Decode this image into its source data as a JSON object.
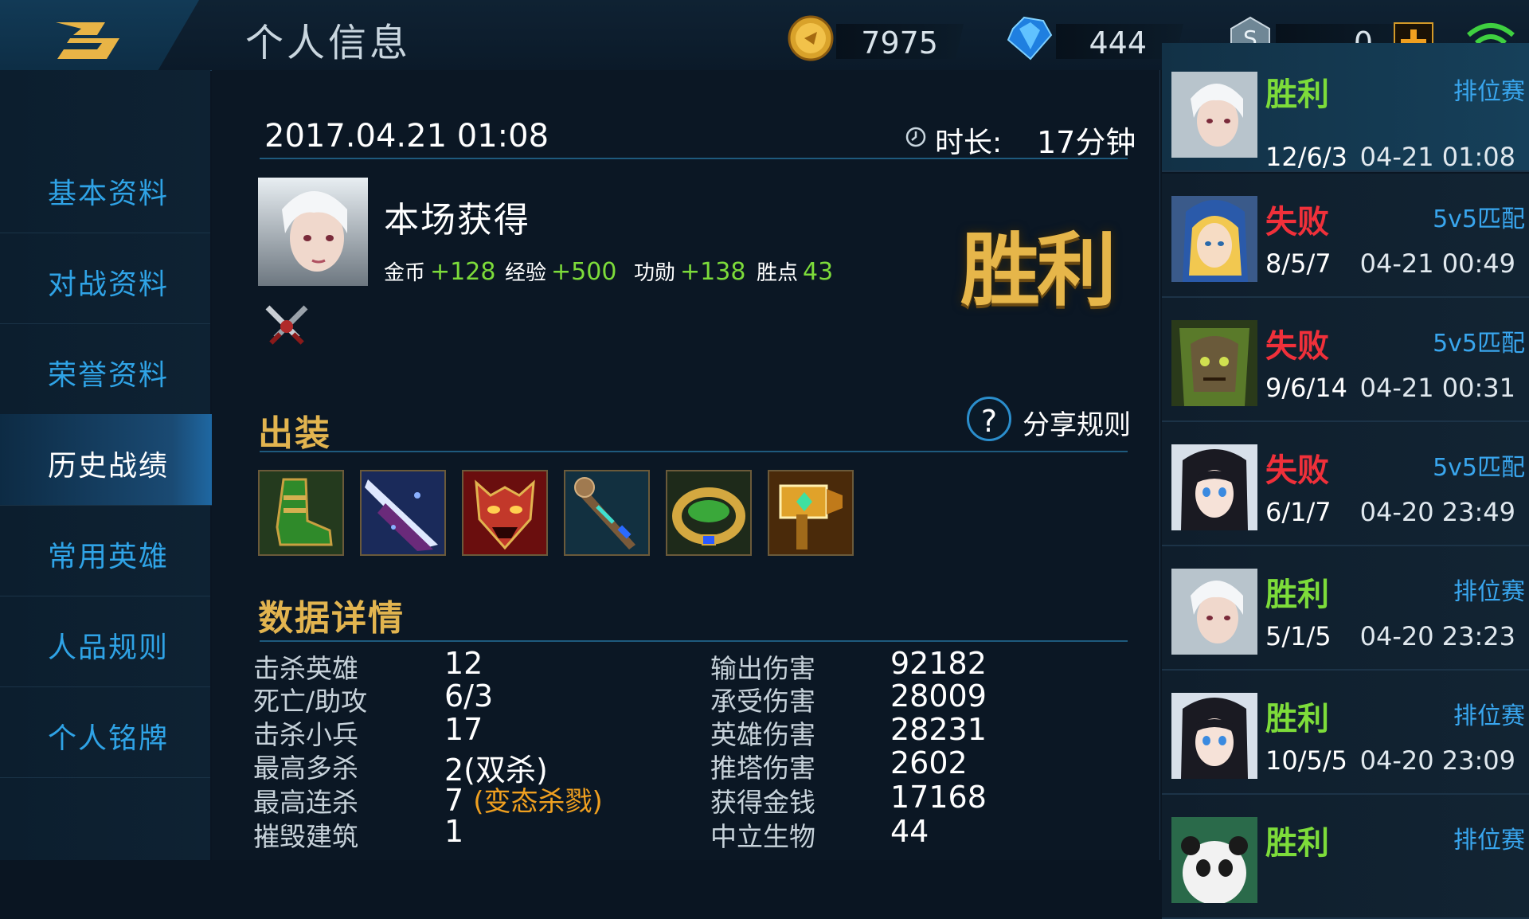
{
  "page_title": "个人信息",
  "currency": {
    "gold": "7975",
    "diamond": "444",
    "voucher": "0"
  },
  "sidebar": {
    "items": [
      {
        "label": "基本资料"
      },
      {
        "label": "对战资料"
      },
      {
        "label": "荣誉资料"
      },
      {
        "label": "历史战绩"
      },
      {
        "label": "常用英雄"
      },
      {
        "label": "人品规则"
      },
      {
        "label": "个人铭牌"
      }
    ],
    "active_index": 3
  },
  "match": {
    "datetime": "2017.04.21 01:08",
    "duration_label": "时长:",
    "duration_value": "17分钟",
    "earned_title": "本场获得",
    "rewards": [
      {
        "label": "金币",
        "value": "+128"
      },
      {
        "label": "经验",
        "value": "+500"
      },
      {
        "label": "功勋",
        "value": "+138"
      },
      {
        "label": "胜点",
        "value": "43"
      }
    ],
    "result_badge": "胜利"
  },
  "gear": {
    "title": "出装",
    "share_label": "分享规则",
    "items": [
      "boots",
      "blade",
      "demon-mask",
      "staff",
      "ring",
      "hammer"
    ]
  },
  "stats": {
    "title": "数据详情",
    "left": [
      {
        "label": "击杀英雄",
        "value": "12"
      },
      {
        "label": "死亡/助攻",
        "value": "6/3"
      },
      {
        "label": "击杀小兵",
        "value": "17"
      },
      {
        "label": "最高多杀",
        "value": "2(双杀)"
      },
      {
        "label": "最高连杀",
        "value": "7",
        "extra": "(变态杀戮)"
      },
      {
        "label": "摧毁建筑",
        "value": "1"
      }
    ],
    "right": [
      {
        "label": "输出伤害",
        "value": "92182"
      },
      {
        "label": "承受伤害",
        "value": "28009"
      },
      {
        "label": "英雄伤害",
        "value": "28231"
      },
      {
        "label": "推塔伤害",
        "value": "2602"
      },
      {
        "label": "获得金钱",
        "value": "17168"
      },
      {
        "label": "中立生物",
        "value": "44"
      }
    ]
  },
  "history": [
    {
      "result": "胜利",
      "mode": "排位赛",
      "kda": "12/6/3",
      "time": "04-21 01:08",
      "hero": "elf",
      "win": true
    },
    {
      "result": "失败",
      "mode": "5v5匹配",
      "kda": "8/5/7",
      "time": "04-21 00:49",
      "hero": "blonde",
      "win": false
    },
    {
      "result": "失败",
      "mode": "5v5匹配",
      "kda": "9/6/14",
      "time": "04-21 00:31",
      "hero": "tree",
      "win": false
    },
    {
      "result": "失败",
      "mode": "5v5匹配",
      "kda": "6/1/7",
      "time": "04-20 23:49",
      "hero": "darkhair",
      "win": false
    },
    {
      "result": "胜利",
      "mode": "排位赛",
      "kda": "5/1/5",
      "time": "04-20 23:23",
      "hero": "elf",
      "win": true
    },
    {
      "result": "胜利",
      "mode": "排位赛",
      "kda": "10/5/5",
      "time": "04-20 23:09",
      "hero": "darkhair",
      "win": true
    },
    {
      "result": "胜利",
      "mode": "排位赛",
      "kda": "",
      "time": "",
      "hero": "panda",
      "win": true
    }
  ]
}
